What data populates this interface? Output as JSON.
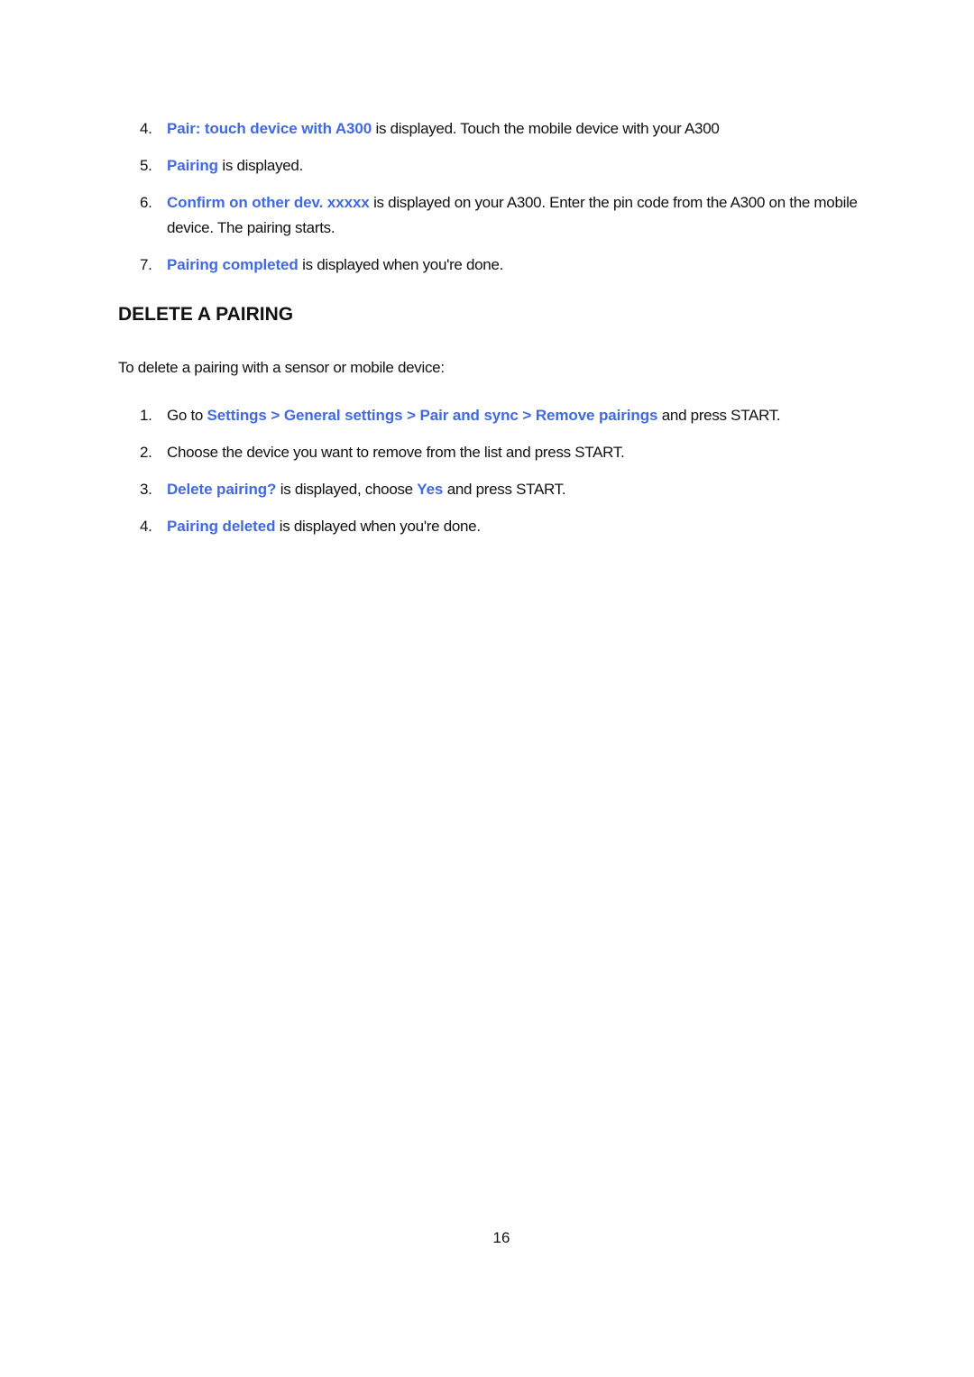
{
  "list_top": {
    "items": [
      {
        "number": "4.",
        "highlight": "Pair: touch device with A300",
        "rest": " is displayed. Touch the mobile device with your A300"
      },
      {
        "number": "5.",
        "highlight": "Pairing",
        "rest": " is displayed."
      },
      {
        "number": "6.",
        "highlight": "Confirm on other dev. xxxxx",
        "rest": " is displayed on your A300. Enter the pin code from the A300 on the mobile device. The pairing starts."
      },
      {
        "number": "7.",
        "highlight": "Pairing completed",
        "rest": " is displayed when you're done."
      }
    ]
  },
  "section": {
    "heading": "DELETE A PAIRING",
    "intro": "To delete a pairing with a sensor or mobile device:",
    "items": [
      {
        "number": "1.",
        "pre": "Go to ",
        "highlight": "Settings > General settings > Pair and sync > Remove pairings",
        "rest": " and press START."
      },
      {
        "number": "2.",
        "rest": "Choose the device you want to remove from the list and press START."
      },
      {
        "number": "3.",
        "highlight": "Delete pairing?",
        "mid": " is displayed, choose ",
        "highlight2": "Yes",
        "rest": " and press START."
      },
      {
        "number": "4.",
        "highlight": "Pairing deleted",
        "rest": " is displayed when you're done."
      }
    ]
  },
  "footer": {
    "page_number": "16"
  },
  "colors": {
    "highlight": "#4169E1",
    "text": "#111111"
  }
}
